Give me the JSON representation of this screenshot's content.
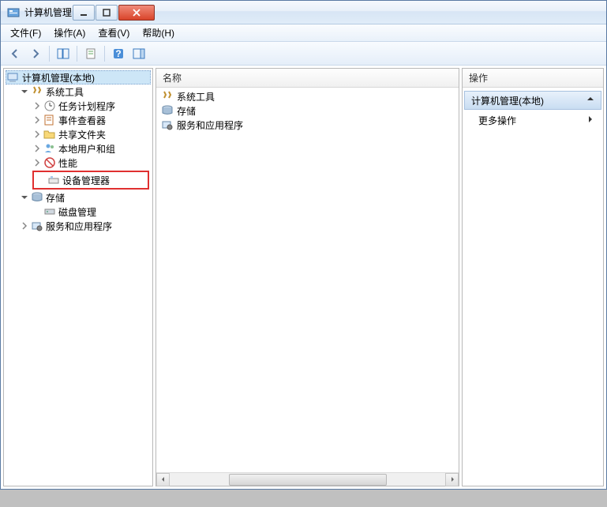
{
  "window": {
    "title": "计算机管理"
  },
  "menu": {
    "file": "文件(F)",
    "actions": "操作(A)",
    "view": "查看(V)",
    "help": "帮助(H)"
  },
  "tree": {
    "root": "计算机管理(本地)",
    "system_tools": "系统工具",
    "task_scheduler": "任务计划程序",
    "event_viewer": "事件查看器",
    "shared_folders": "共享文件夹",
    "local_users": "本地用户和组",
    "performance": "性能",
    "device_manager": "设备管理器",
    "storage": "存储",
    "disk_mgmt": "磁盘管理",
    "services_apps": "服务和应用程序"
  },
  "list": {
    "header": "名称",
    "items": {
      "system_tools": "系统工具",
      "storage": "存储",
      "services_apps": "服务和应用程序"
    }
  },
  "actions_panel": {
    "header": "操作",
    "section_title": "计算机管理(本地)",
    "more_actions": "更多操作"
  }
}
